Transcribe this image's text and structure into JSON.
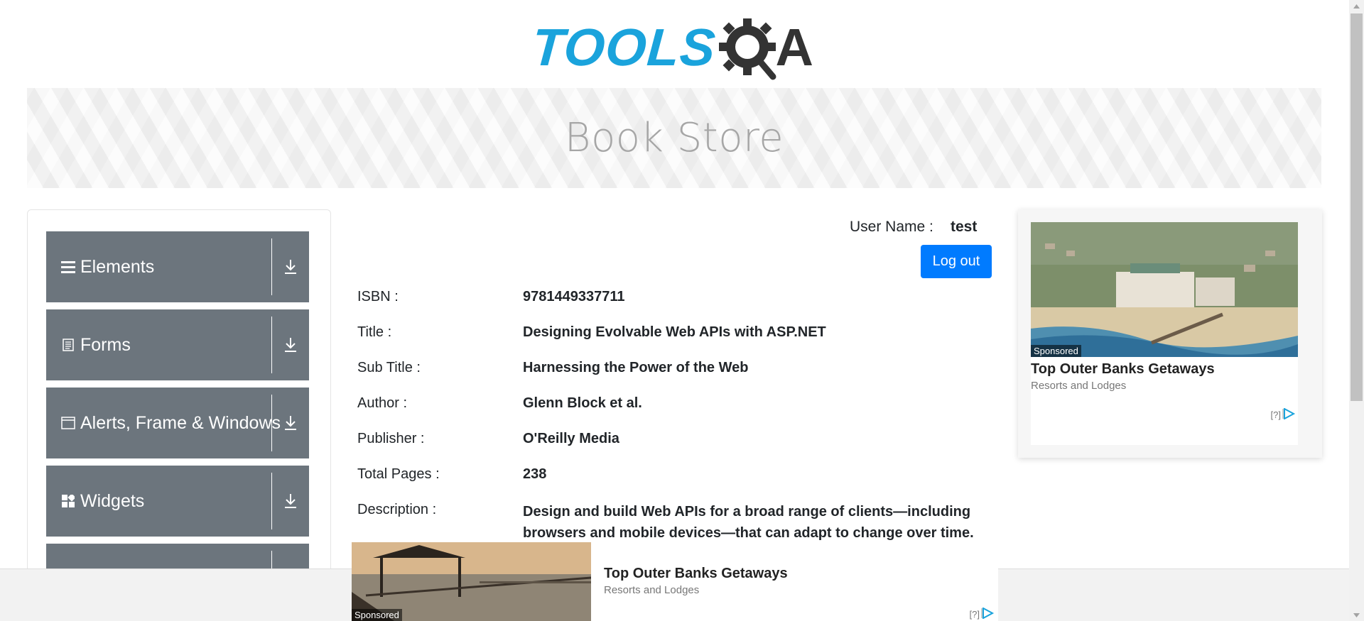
{
  "header": {
    "logo_text": "TOOLS",
    "logo_suffix": "A",
    "page_title": "Book Store"
  },
  "sidebar": {
    "groups": [
      {
        "label": "Elements",
        "icon": "hamburger-icon"
      },
      {
        "label": "Forms",
        "icon": "document-icon"
      },
      {
        "label": "Alerts, Frame & Windows",
        "icon": "window-icon"
      },
      {
        "label": "Widgets",
        "icon": "widgets-icon"
      },
      {
        "label": "",
        "icon": ""
      }
    ]
  },
  "user": {
    "label": "User Name :",
    "value": "test",
    "logout_label": "Log out"
  },
  "book": {
    "isbn_label": "ISBN :",
    "isbn": "9781449337711",
    "title_label": "Title :",
    "title": "Designing Evolvable Web APIs with ASP.NET",
    "subtitle_label": "Sub Title :",
    "subtitle": "Harnessing the Power of the Web",
    "author_label": "Author :",
    "author": "Glenn Block et al.",
    "publisher_label": "Publisher :",
    "publisher": "O'Reilly Media",
    "pages_label": "Total Pages :",
    "pages": "238",
    "description_label": "Description :",
    "description": "Design and build Web APIs for a broad range of clients—including browsers and mobile devices—that can adapt to change over time. This"
  },
  "right_ad": {
    "sponsored": "Sponsored",
    "title": "Top Outer Banks Getaways",
    "subtitle": "Resorts and Lodges",
    "info": "[?]"
  },
  "bottom_ad": {
    "sponsored": "Sponsored",
    "title": "Top Outer Banks Getaways",
    "subtitle": "Resorts and Lodges",
    "info": "[?]"
  },
  "colors": {
    "logo_blue": "#1aa3dc",
    "accordion_gray": "#6c757d",
    "button_blue": "#007bff"
  }
}
